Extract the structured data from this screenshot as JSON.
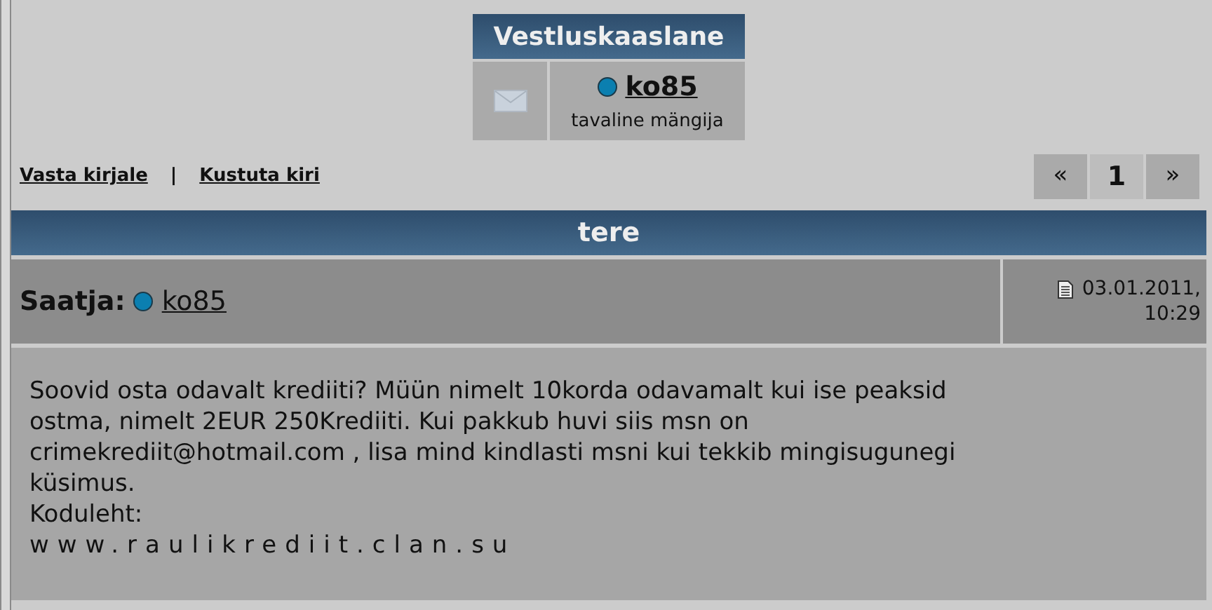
{
  "partner_box": {
    "title": "Vestluskaaslane",
    "user": {
      "name": "ko85",
      "online": true,
      "rank": "tavaline mängija"
    }
  },
  "actions": [
    {
      "label": "Vasta kirjale"
    },
    {
      "label": "|"
    },
    {
      "label": "Kustuta kiri"
    }
  ],
  "pager": [
    {
      "label": "«",
      "selected": false
    },
    {
      "label": "1",
      "selected": true
    },
    {
      "label": "»",
      "selected": false
    }
  ],
  "message": {
    "subject": "tere",
    "sender_label": "Saatja:",
    "sender": {
      "name": "ko85",
      "online": true
    },
    "date": "03.01.2011,",
    "time": "10:29",
    "body_lines": [
      "Soovid osta odavalt krediiti? Müün nimelt 10korda odavamalt kui ise peaksid",
      "ostma, nimelt 2EUR 250Krediiti. Kui pakkub huvi siis msn on",
      "crimekrediit@hotmail.com , lisa mind kindlasti msni kui tekkib mingisugunegi",
      "küsimus.",
      "Koduleht:"
    ],
    "website": "www.raulikrediit.clan.su"
  }
}
